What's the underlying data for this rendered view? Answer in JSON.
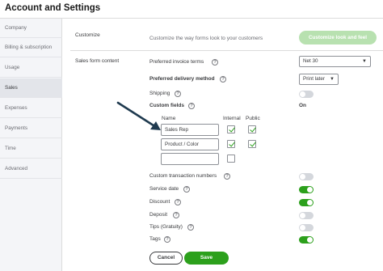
{
  "window": {
    "title": "Account and Settings"
  },
  "sidebar": {
    "items": [
      {
        "label": "Company"
      },
      {
        "label": "Billing & subscription"
      },
      {
        "label": "Usage"
      },
      {
        "label": "Sales",
        "active": true
      },
      {
        "label": "Expenses"
      },
      {
        "label": "Payments"
      },
      {
        "label": "Time"
      },
      {
        "label": "Advanced"
      }
    ]
  },
  "customize": {
    "section_label": "Customize",
    "description": "Customize the way forms look to your customers",
    "button_label": "Customize look and feel"
  },
  "sales_form": {
    "section_label": "Sales form content",
    "preferred_invoice_terms": {
      "label": "Preferred invoice terms",
      "value": "Net 30"
    },
    "preferred_delivery_method": {
      "label": "Preferred delivery method",
      "value": "Print later"
    },
    "shipping": {
      "label": "Shipping",
      "on": false
    },
    "custom_fields": {
      "label": "Custom fields",
      "status": "On",
      "col_name": "Name",
      "col_internal": "Internal",
      "col_public": "Public",
      "rows": [
        {
          "name": "Sales Rep",
          "internal": true,
          "public": true
        },
        {
          "name": "Product / Color",
          "internal": true,
          "public": true
        },
        {
          "name": "",
          "internal": false,
          "public": false
        }
      ]
    },
    "custom_transaction_numbers": {
      "label": "Custom transaction numbers",
      "on": false
    },
    "service_date": {
      "label": "Service date",
      "on": true
    },
    "discount": {
      "label": "Discount",
      "on": true
    },
    "deposit": {
      "label": "Deposit",
      "on": false
    },
    "tips": {
      "label": "Tips (Gratuity)",
      "on": false
    },
    "tags": {
      "label": "Tags",
      "on": true
    }
  },
  "footer": {
    "cancel_label": "Cancel",
    "save_label": "Save"
  },
  "colors": {
    "accent": "#2ca01c",
    "accent_light": "#b8e1b0",
    "arrow": "#1f3a4f"
  },
  "icons": {
    "help": "question-circle-icon",
    "caret": "chevron-down-icon",
    "annotation": "arrow-annotation"
  }
}
